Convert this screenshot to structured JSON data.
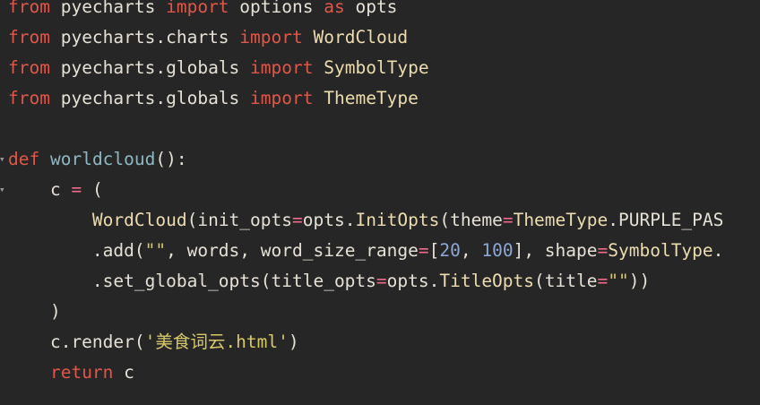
{
  "editor": {
    "language": "python",
    "theme": {
      "background": "#262626",
      "keyword": "#e0574a",
      "function_name": "#8fb8c4",
      "class_name": "#ecdcaf",
      "string": "#d7c86a",
      "number": "#8ea7d4",
      "operator": "#ef6a8c",
      "text": "#e6e1d6"
    },
    "lines": [
      {
        "tokens": [
          "from",
          " pyecharts ",
          "import",
          " options ",
          "as",
          " opts"
        ]
      },
      {
        "tokens": [
          "from",
          " pyecharts.charts ",
          "import",
          " ",
          "WordCloud"
        ]
      },
      {
        "tokens": [
          "from",
          " pyecharts.globals ",
          "import",
          " ",
          "SymbolType"
        ]
      },
      {
        "tokens": [
          "from",
          " pyecharts.globals ",
          "import",
          " ",
          "ThemeType"
        ]
      },
      {
        "tokens": []
      },
      {
        "fold": "▾",
        "tokens": [
          "def",
          " ",
          "worldcloud",
          "():"
        ]
      },
      {
        "fold": "▾",
        "tokens": [
          "    c ",
          "=",
          " ("
        ]
      },
      {
        "tokens": [
          "        ",
          "WordCloud",
          "(init_opts",
          "=",
          "opts.",
          "InitOpts",
          "(theme",
          "=",
          "ThemeType",
          ".PURPLE_PAS"
        ]
      },
      {
        "tokens": [
          "        .add(",
          "\"\"",
          ", words, word_size_range",
          "=",
          "[",
          "20",
          ", ",
          "100",
          "], shape",
          "=",
          "SymbolType",
          "."
        ]
      },
      {
        "tokens": [
          "        .set_global_opts(title_opts",
          "=",
          "opts.",
          "TitleOpts",
          "(title",
          "=",
          "\"\"",
          "))"
        ]
      },
      {
        "tokens": [
          "    )"
        ]
      },
      {
        "tokens": [
          "    c.render(",
          "'美食词云.html'",
          ")"
        ]
      },
      {
        "tokens": [
          "    ",
          "return",
          " c"
        ]
      }
    ]
  }
}
